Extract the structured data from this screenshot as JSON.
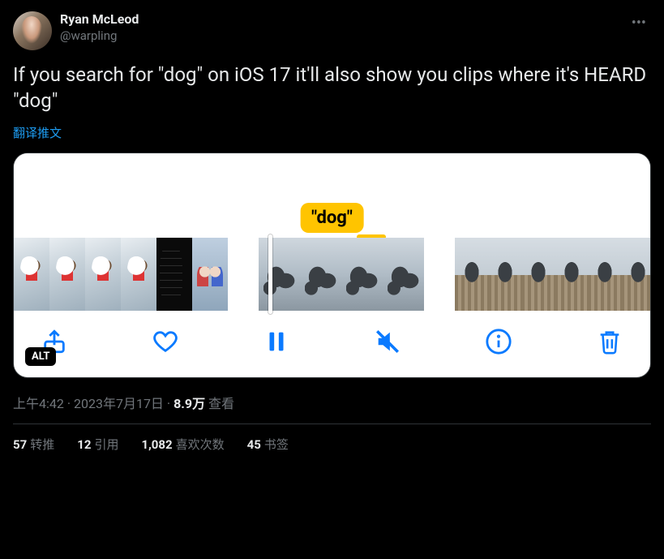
{
  "author": {
    "display_name": "Ryan McLeod",
    "handle": "@warpling"
  },
  "tweet_text": "If you search for \"dog\" on iOS 17 it'll also show you clips where it's HEARD \"dog\"",
  "translate_label": "翻译推文",
  "media": {
    "caption_label": "\"dog\"",
    "alt_badge": "ALT"
  },
  "meta": {
    "time": "上午4:42",
    "date": "2023年7月17日",
    "views_count": "8.9万",
    "views_label": "查看"
  },
  "stats": {
    "retweets_count": "57",
    "retweets_label": "转推",
    "quotes_count": "12",
    "quotes_label": "引用",
    "likes_count": "1,082",
    "likes_label": "喜欢次数",
    "bookmarks_count": "45",
    "bookmarks_label": "书签"
  }
}
